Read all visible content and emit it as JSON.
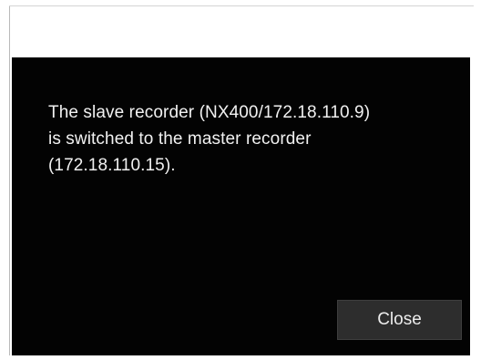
{
  "dialog": {
    "message_lines": [
      "The slave recorder (NX400/172.18.110.9)",
      "is switched to the master recorder",
      "(172.18.110.15)."
    ],
    "close_label": "Close"
  },
  "colors": {
    "dialog_background": "#030303",
    "text": "#f1f1f1",
    "button_background": "#2d2d2d"
  }
}
